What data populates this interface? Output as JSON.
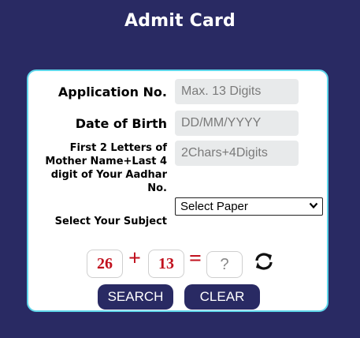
{
  "page": {
    "title": "Admit Card"
  },
  "form": {
    "application_label": "Application No.",
    "application_placeholder": "Max. 13 Digits",
    "dob_label": "Date of Birth",
    "dob_placeholder": "DD/MM/YYYY",
    "mother_label_lines": [
      "First 2 Letters of",
      "Mother Name+Last 4",
      "digit of Your Aadhar",
      "No."
    ],
    "mother_placeholder": "2Chars+4Digits",
    "subject_label": "Select Your Subject",
    "subject_selected": "Select Paper"
  },
  "captcha": {
    "num1": "26",
    "operator": "+",
    "num2": "13",
    "equals": "=",
    "answer_placeholder": "?"
  },
  "buttons": {
    "search": "SEARCH",
    "clear": "CLEAR"
  },
  "icons": {
    "refresh": "refresh-icon",
    "dropdown": "chevron-down-icon"
  },
  "colors": {
    "background": "#292a63",
    "card_border": "#5fd6ea",
    "captcha_text": "#c1111e",
    "button": "#292a63"
  }
}
